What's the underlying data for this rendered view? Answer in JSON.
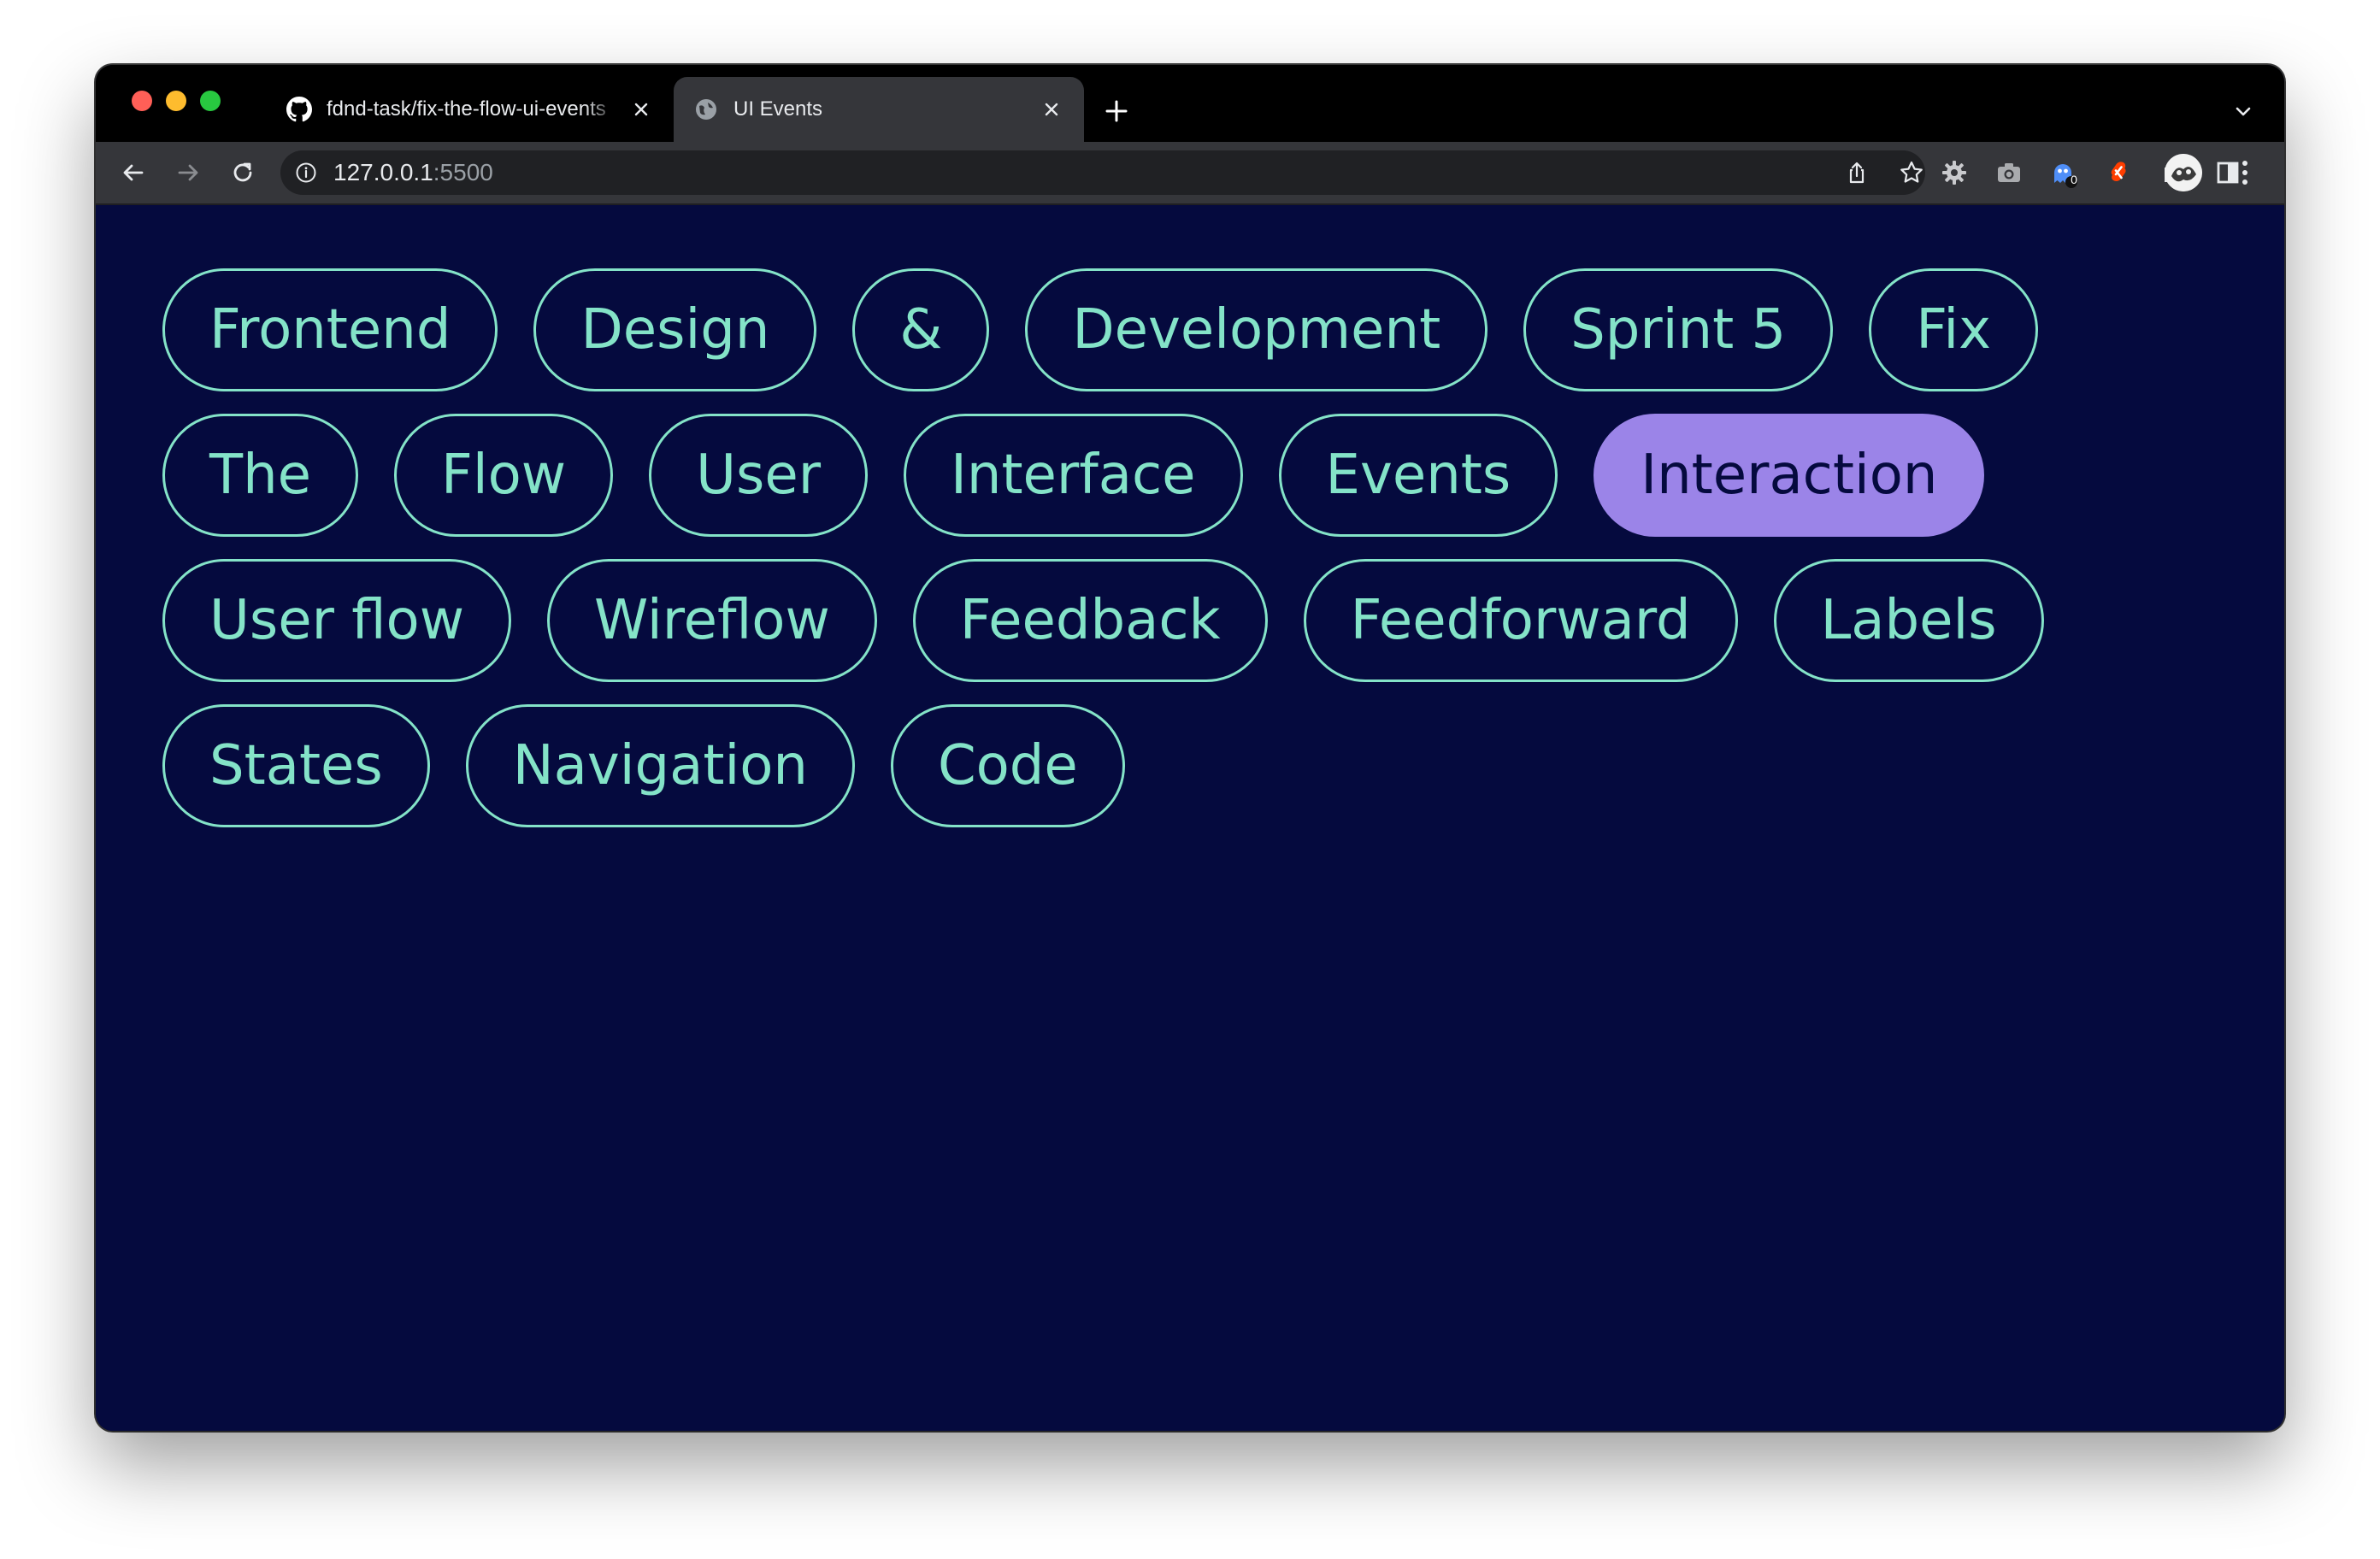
{
  "browser": {
    "tabs": [
      {
        "title": "fdnd-task/fix-the-flow-ui-events",
        "favicon": "github-icon"
      },
      {
        "title": "UI Events",
        "favicon": "globe-icon"
      }
    ],
    "address": {
      "host": "127.0.0.1",
      "port": ":5500"
    },
    "extension_badge": "0"
  },
  "page": {
    "background_color": "#050a3e",
    "accent_color": "#84e3c8",
    "active_color": "#9b84e8",
    "tags": [
      {
        "label": "Frontend",
        "active": false
      },
      {
        "label": "Design",
        "active": false
      },
      {
        "label": "&",
        "active": false
      },
      {
        "label": "Development",
        "active": false
      },
      {
        "label": "Sprint 5",
        "active": false
      },
      {
        "label": "Fix",
        "active": false
      },
      {
        "label": "The",
        "active": false
      },
      {
        "label": "Flow",
        "active": false
      },
      {
        "label": "User",
        "active": false
      },
      {
        "label": "Interface",
        "active": false
      },
      {
        "label": "Events",
        "active": false
      },
      {
        "label": "Interaction",
        "active": true
      },
      {
        "label": "User flow",
        "active": false
      },
      {
        "label": "Wireflow",
        "active": false
      },
      {
        "label": "Feedback",
        "active": false
      },
      {
        "label": "Feedforward",
        "active": false
      },
      {
        "label": "Labels",
        "active": false
      },
      {
        "label": "States",
        "active": false
      },
      {
        "label": "Navigation",
        "active": false
      },
      {
        "label": "Code",
        "active": false
      }
    ]
  }
}
